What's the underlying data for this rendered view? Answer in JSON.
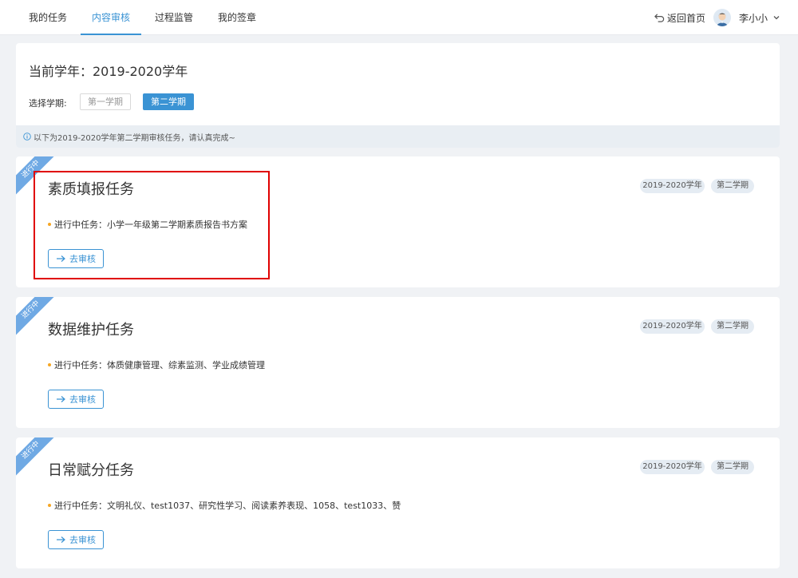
{
  "nav": {
    "tabs": [
      "我的任务",
      "内容审核",
      "过程监管",
      "我的签章"
    ],
    "active_tab": 1,
    "back_label": "返回首页",
    "user_name": "李小小"
  },
  "header": {
    "year_title": "当前学年：2019-2020学年",
    "semester_label": "选择学期:",
    "semester_options": [
      "第一学期",
      "第二学期"
    ],
    "selected_semester": "第二学期",
    "notice": "以下为2019-2020学年第二学期审核任务，请认真完成~"
  },
  "tasks": [
    {
      "ribbon": "进行中",
      "title": "素质填报任务",
      "line": "进行中任务：小学一年级第二学期素质报告书方案",
      "button": "去审核",
      "tag_year": "2019-2020学年",
      "tag_semester": "第二学期",
      "highlighted": true
    },
    {
      "ribbon": "进行中",
      "title": "数据维护任务",
      "line": "进行中任务：体质健康管理、综素监测、学业成绩管理",
      "button": "去审核",
      "tag_year": "2019-2020学年",
      "tag_semester": "第二学期",
      "highlighted": false
    },
    {
      "ribbon": "进行中",
      "title": "日常赋分任务",
      "line": "进行中任务：文明礼仪、test1037、研究性学习、阅读素养表现、1058、test1033、赞",
      "button": "去审核",
      "tag_year": "2019-2020学年",
      "tag_semester": "第二学期",
      "highlighted": false
    }
  ],
  "colors": {
    "accent": "#3a93d4",
    "ribbon": "#6fa9e4",
    "dot": "#f5a623",
    "highlight": "#e00000"
  }
}
